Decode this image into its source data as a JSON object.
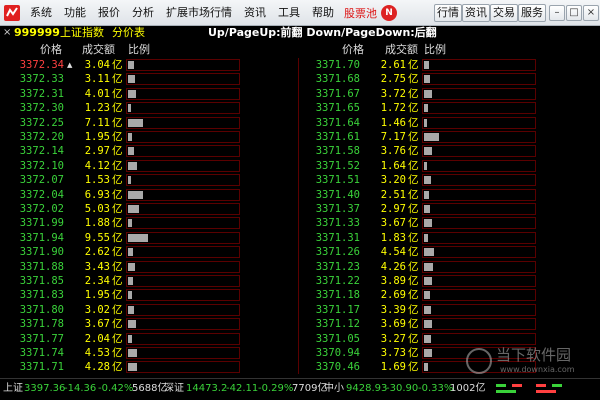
{
  "menu": {
    "items": [
      "系统",
      "功能",
      "报价",
      "分析",
      "扩展市场行情",
      "资讯",
      "工具",
      "帮助"
    ],
    "stock_pool": "股票池",
    "new_badge": "N",
    "right_buttons": [
      "行情",
      "资讯",
      "交易",
      "服务"
    ],
    "window_controls": [
      "minimize-icon",
      "restore-icon",
      "close-icon"
    ]
  },
  "title": {
    "close": "×",
    "code": "999999",
    "index_name": "上证指数",
    "view_name": "分价表",
    "page_hint": "Up/PageUp:前翻 Down/PageDown:后翻"
  },
  "headers": {
    "price": "价格",
    "amount": "成交额",
    "ratio": "比例"
  },
  "unit": "亿",
  "colors": {
    "up": "#ff4040",
    "down": "#3ad23a",
    "amount": "#ffff00",
    "bar": "#a9a9a9",
    "border": "#5a0000"
  },
  "left_rows": [
    {
      "price": "3372.34",
      "amount": "3.04",
      "ratio": 0.318,
      "up": true,
      "marker": "▲"
    },
    {
      "price": "3372.33",
      "amount": "3.11",
      "ratio": 0.326
    },
    {
      "price": "3372.31",
      "amount": "4.01",
      "ratio": 0.42
    },
    {
      "price": "3372.30",
      "amount": "1.23",
      "ratio": 0.129
    },
    {
      "price": "3372.25",
      "amount": "7.11",
      "ratio": 0.745
    },
    {
      "price": "3372.20",
      "amount": "1.95",
      "ratio": 0.204
    },
    {
      "price": "3372.14",
      "amount": "2.97",
      "ratio": 0.311
    },
    {
      "price": "3372.10",
      "amount": "4.12",
      "ratio": 0.431
    },
    {
      "price": "3372.07",
      "amount": "1.53",
      "ratio": 0.16
    },
    {
      "price": "3372.04",
      "amount": "6.93",
      "ratio": 0.726
    },
    {
      "price": "3372.02",
      "amount": "5.03",
      "ratio": 0.527
    },
    {
      "price": "3371.99",
      "amount": "1.88",
      "ratio": 0.197
    },
    {
      "price": "3371.94",
      "amount": "9.55",
      "ratio": 1.0
    },
    {
      "price": "3371.90",
      "amount": "2.62",
      "ratio": 0.274
    },
    {
      "price": "3371.88",
      "amount": "3.43",
      "ratio": 0.359
    },
    {
      "price": "3371.85",
      "amount": "2.34",
      "ratio": 0.245
    },
    {
      "price": "3371.83",
      "amount": "1.95",
      "ratio": 0.204
    },
    {
      "price": "3371.80",
      "amount": "3.02",
      "ratio": 0.316
    },
    {
      "price": "3371.78",
      "amount": "3.67",
      "ratio": 0.384
    },
    {
      "price": "3371.77",
      "amount": "2.04",
      "ratio": 0.214
    },
    {
      "price": "3371.74",
      "amount": "4.53",
      "ratio": 0.474
    },
    {
      "price": "3371.71",
      "amount": "4.28",
      "ratio": 0.448
    }
  ],
  "right_rows": [
    {
      "price": "3371.70",
      "amount": "2.61",
      "ratio": 0.273
    },
    {
      "price": "3371.68",
      "amount": "2.75",
      "ratio": 0.288
    },
    {
      "price": "3371.67",
      "amount": "3.72",
      "ratio": 0.39
    },
    {
      "price": "3371.65",
      "amount": "1.72",
      "ratio": 0.18
    },
    {
      "price": "3371.64",
      "amount": "1.46",
      "ratio": 0.153
    },
    {
      "price": "3371.61",
      "amount": "7.17",
      "ratio": 0.751
    },
    {
      "price": "3371.58",
      "amount": "3.76",
      "ratio": 0.394
    },
    {
      "price": "3371.52",
      "amount": "1.64",
      "ratio": 0.172
    },
    {
      "price": "3371.51",
      "amount": "3.20",
      "ratio": 0.335
    },
    {
      "price": "3371.40",
      "amount": "2.51",
      "ratio": 0.263
    },
    {
      "price": "3371.37",
      "amount": "2.97",
      "ratio": 0.311
    },
    {
      "price": "3371.33",
      "amount": "3.67",
      "ratio": 0.384
    },
    {
      "price": "3371.31",
      "amount": "1.83",
      "ratio": 0.192
    },
    {
      "price": "3371.26",
      "amount": "4.54",
      "ratio": 0.475
    },
    {
      "price": "3371.23",
      "amount": "4.26",
      "ratio": 0.446
    },
    {
      "price": "3371.22",
      "amount": "3.89",
      "ratio": 0.407
    },
    {
      "price": "3371.18",
      "amount": "2.69",
      "ratio": 0.282
    },
    {
      "price": "3371.17",
      "amount": "3.39",
      "ratio": 0.355
    },
    {
      "price": "3371.12",
      "amount": "3.69",
      "ratio": 0.386
    },
    {
      "price": "3371.05",
      "amount": "3.27",
      "ratio": 0.342
    },
    {
      "price": "3370.94",
      "amount": "3.73",
      "ratio": 0.391
    },
    {
      "price": "3370.46",
      "amount": "1.69",
      "ratio": 0.177
    }
  ],
  "status": {
    "sh_label": "上证",
    "sh_value": "3397.36",
    "sh_change": "-14.36",
    "sh_pct": "-0.42%",
    "sh_volume": "5688亿",
    "sz_label": "深证",
    "sz_value": "14473.2",
    "sz_change": "-42.11",
    "sz_pct": "-0.29%",
    "sz_volume": "7709亿",
    "zx_label": "中小",
    "zx_value": "9428.93",
    "zx_change": "-30.90",
    "zx_pct": "-0.33%",
    "zx_volume": "1002亿"
  },
  "watermark": {
    "text": "当下软件园",
    "url": "www.downxia.com"
  }
}
